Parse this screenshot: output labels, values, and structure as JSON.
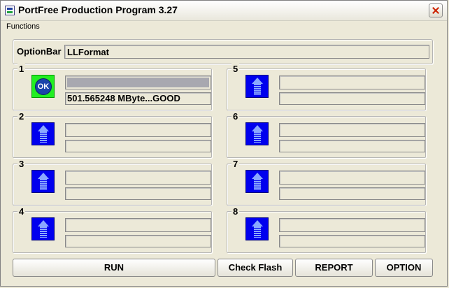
{
  "window": {
    "title": "PortFree Production Program 3.27"
  },
  "menu": {
    "functions": "Functions"
  },
  "option_bar": {
    "label": "OptionBar",
    "value": "LLFormat"
  },
  "ports": [
    {
      "number": "1",
      "status": "ok",
      "status_text": "OK",
      "progress": 1.0,
      "message": "501.565248 MByte...GOOD"
    },
    {
      "number": "2",
      "status": "idle",
      "progress": 0,
      "message": ""
    },
    {
      "number": "3",
      "status": "idle",
      "progress": 0,
      "message": ""
    },
    {
      "number": "4",
      "status": "idle",
      "progress": 0,
      "message": ""
    },
    {
      "number": "5",
      "status": "idle",
      "progress": 0,
      "message": ""
    },
    {
      "number": "6",
      "status": "idle",
      "progress": 0,
      "message": ""
    },
    {
      "number": "7",
      "status": "idle",
      "progress": 0,
      "message": ""
    },
    {
      "number": "8",
      "status": "idle",
      "progress": 0,
      "message": ""
    }
  ],
  "buttons": {
    "run": "RUN",
    "check_flash": "Check Flash",
    "report": "REPORT",
    "option": "OPTION"
  },
  "colors": {
    "idle_indicator": "#0000ee",
    "ok_indicator": "#22ee22",
    "ok_circle": "#1a44aa"
  },
  "icons": {
    "idle": "upload-arrow-icon",
    "ok": "ok-circle-icon"
  }
}
